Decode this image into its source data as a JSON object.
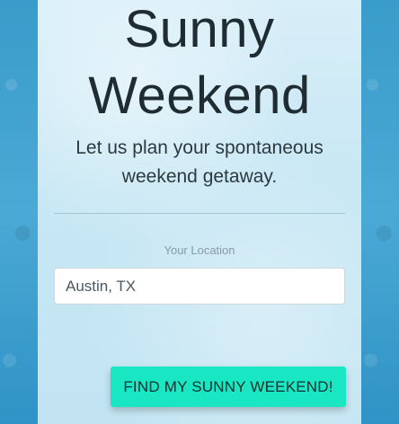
{
  "page": {
    "title_line1": "Sunny",
    "title_line2": "Weekend",
    "subtitle_line1": "Let us plan your spontaneous",
    "subtitle_line2": "weekend getaway."
  },
  "form": {
    "location_label": "Your Location",
    "location_value": "Austin, TX",
    "submit_label": "FIND MY SUNNY WEEKEND!"
  },
  "colors": {
    "background": "#3b9ccb",
    "panel": "#cfe9f5",
    "accent": "#19e7c4",
    "title_text": "#1f2d33",
    "label_text": "#8a9aa3"
  }
}
